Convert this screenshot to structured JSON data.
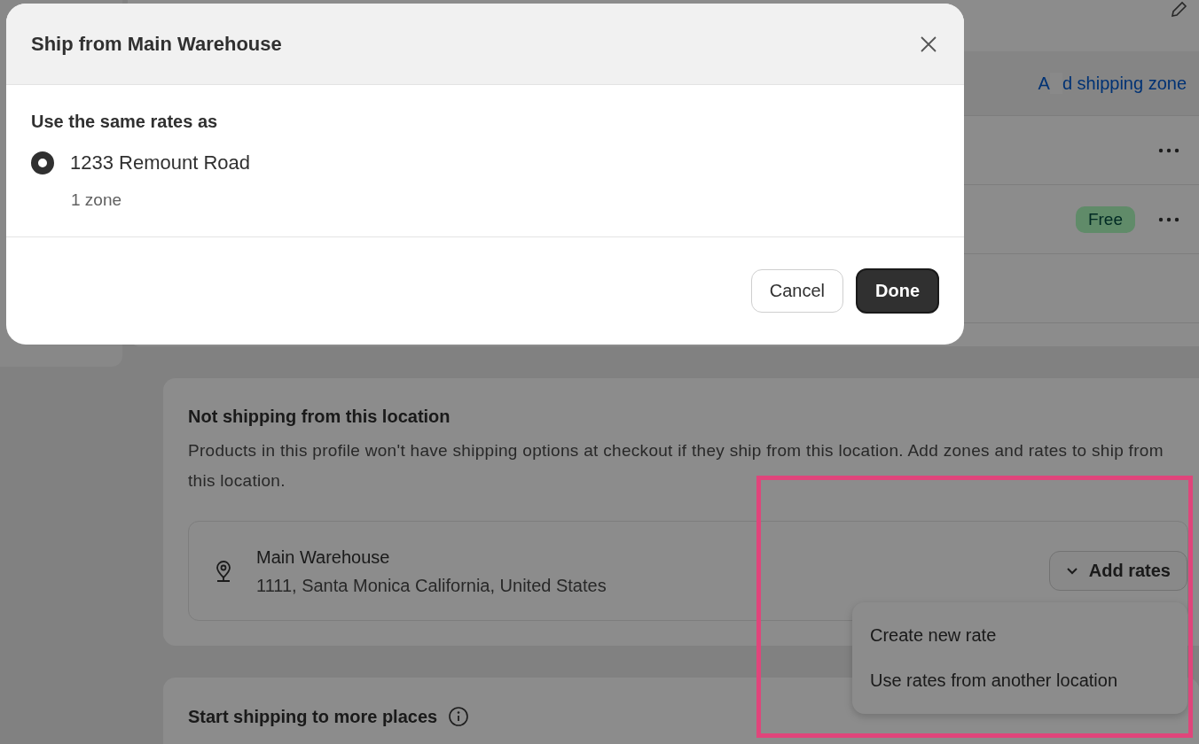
{
  "background_page": {
    "zones_link_parts": [
      "A",
      "d shipping zone"
    ],
    "zone_rows": [
      {
        "menu": true
      },
      {
        "badge": "Free",
        "menu": true
      },
      {
        "menu": false
      },
      {
        "menu": false
      }
    ],
    "not_shipping": {
      "title": "Not shipping from this location",
      "description": "Products in this profile won't have shipping options at checkout if they ship from this location. Add zones and rates to ship from this location.",
      "location": {
        "name": "Main Warehouse",
        "address": "1111, Santa Monica California, United States"
      },
      "add_rates": {
        "label": "Add rates",
        "expanded": true,
        "highlighted": true,
        "menu_items": [
          {
            "label": "Create new rate"
          },
          {
            "label": "Use rates from another location"
          }
        ]
      }
    },
    "more_places": {
      "title": "Start shipping to more places"
    }
  },
  "modal": {
    "title": "Ship from Main Warehouse",
    "section_label": "Use the same rates as",
    "options": [
      {
        "label": "1233 Remount Road",
        "detail": "1 zone",
        "selected": true
      }
    ],
    "buttons": [
      {
        "label": "Cancel",
        "kind": "secondary"
      },
      {
        "label": "Done",
        "kind": "primary"
      }
    ]
  }
}
